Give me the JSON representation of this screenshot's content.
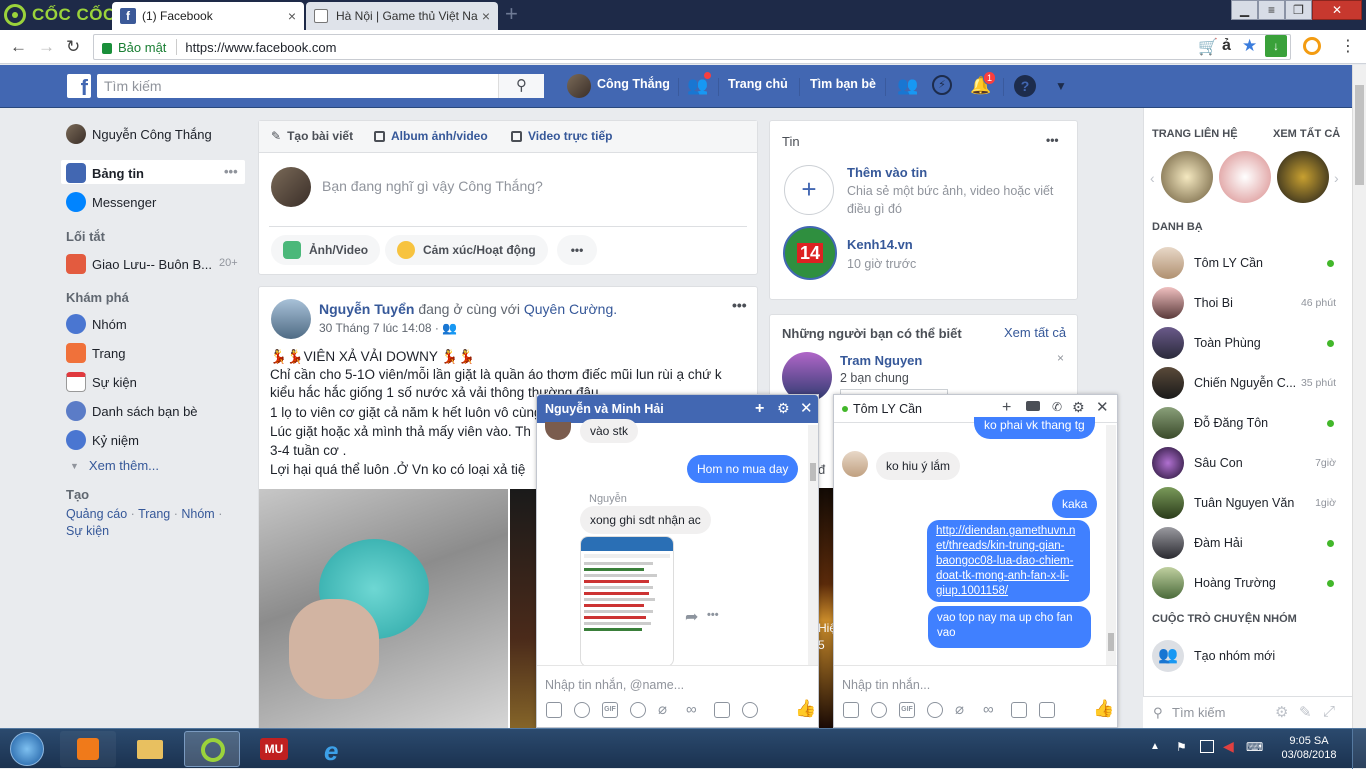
{
  "browser": {
    "brand": "CỐC CỐC",
    "tabs": [
      {
        "title": "(1) Facebook",
        "favicon": "f"
      },
      {
        "title": "Hà Nội | Game thủ Việt Na"
      }
    ],
    "url": "https://www.facebook.com",
    "secure_label": "Bảo mật",
    "lang_badge": "ả",
    "window_controls": [
      "▁",
      "❐",
      "✕"
    ]
  },
  "fb_header": {
    "search_placeholder": "Tìm kiếm",
    "user_name": "Công Thắng",
    "links": [
      "Trang chủ",
      "Tìm bạn bè"
    ],
    "notif_count": "1",
    "colors": {
      "bar": "#4267b2"
    }
  },
  "left_nav": {
    "profile": "Nguyễn Công Thắng",
    "main": [
      {
        "label": "Bảng tin",
        "icon": "news-feed-icon"
      },
      {
        "label": "Messenger",
        "icon": "messenger-icon"
      }
    ],
    "shortcuts_title": "Lối tắt",
    "shortcuts": [
      {
        "label": "Giao Lưu-- Buôn B...",
        "count": "20+"
      }
    ],
    "explore_title": "Khám phá",
    "explore": [
      "Nhóm",
      "Trang",
      "Sự kiện",
      "Danh sách bạn bè",
      "Kỷ niệm"
    ],
    "see_more": "Xem thêm...",
    "create_title": "Tạo",
    "create_links": [
      "Quảng cáo",
      "Trang",
      "Nhóm",
      "Sự kiện"
    ]
  },
  "composer": {
    "tabs": [
      "Tạo bài viết",
      "Album ảnh/video",
      "Video trực tiếp"
    ],
    "placeholder": "Bạn đang nghĩ gì vậy Công Thắng?",
    "actions": [
      "Ảnh/Video",
      "Cảm xúc/Hoạt động",
      "•••"
    ]
  },
  "post": {
    "author": "Nguyễn Tuyển",
    "with_text": "đang ở cùng với",
    "with_name": "Quyên Cường.",
    "time": "30 Tháng 7 lúc 14:08 ·",
    "lines": [
      "💃💃VIÊN XẢ VẢI DOWNY 💃💃",
      "Chỉ cần cho 5-1O viên/mỗi lần giặt là quần áo thơm điếc mũi lun rùi ạ chứ k",
      "kiểu hắc hắc giống 1 số nước xả vải thông thường đâu",
      "1 lọ to viên cơ giặt cả năm k hết luôn vô cùng",
      "Lúc giặt hoặc xả mình thả mấy viên vào. Th",
      "3-4 tuần cơ .",
      "Lợi hại quá thể luôn .Ở Vn ko có loại xả tiệ"
    ]
  },
  "stories": {
    "title": "Tin",
    "add_title": "Thêm vào tin",
    "add_desc_1": "Chia sẻ một bức ảnh, video hoặc viết",
    "add_desc_2": "điều gì đó",
    "item_name": "Kenh14.vn",
    "item_time": "10 giờ trước",
    "item_logo": "14"
  },
  "pymk": {
    "title": "Những người bạn có thể biết",
    "see_all": "Xem tất cả",
    "person": "Tram Nguyen",
    "mutual": "2 bạn chung"
  },
  "behind_text": {
    "a": "đ",
    "b": "Hiệ",
    "c": "5"
  },
  "chat1": {
    "title": "Nguyễn và Minh Hải",
    "messages": [
      {
        "text": "vào stk",
        "side": "in"
      },
      {
        "text": "Hom no mua day",
        "side": "out"
      },
      {
        "sender": "Nguyễn"
      },
      {
        "text": "xong ghi sdt nhận ac",
        "side": "in"
      }
    ],
    "input_placeholder": "Nhập tin nhắn, @name..."
  },
  "chat2": {
    "title": "Tôm LY Cần",
    "messages": [
      {
        "text": "ko phai vk thang tg",
        "side": "out"
      },
      {
        "text": "ko hiu ý lắm",
        "side": "in"
      },
      {
        "text": "kaka",
        "side": "out"
      },
      {
        "text": "http://diendan.gamethuvn.n|et/threads/kin-trung-gian-|baongoc08-lua-dao-chiem-|doat-tk-mong-anh-fan-x-li-|giup.1001158/",
        "side": "out"
      },
      {
        "text": "vao top nay ma up cho fan|vao",
        "side": "out"
      }
    ],
    "link_lines": [
      "http://diendan.gamethuvn.n",
      "et/threads/kin-trung-gian-",
      "baongoc08-lua-dao-chiem-",
      "doat-tk-mong-anh-fan-x-li-",
      "giup.1001158/"
    ],
    "last_lines": [
      "vao top nay ma up cho fan",
      "vao"
    ],
    "input_placeholder": "Nhập tin nhắn..."
  },
  "right_sidebar": {
    "contacts_header": "TRANG LIÊN HỆ",
    "see_all": "XEM TẤT CẢ",
    "directory_title": "DANH BẠ",
    "contacts": [
      {
        "name": "Tôm LY Cần",
        "status": "online"
      },
      {
        "name": "Thoi Bi",
        "status": "46 phút"
      },
      {
        "name": "Toàn Phùng",
        "status": "online"
      },
      {
        "name": "Chiến Nguyễn C...",
        "status": "35 phút"
      },
      {
        "name": "Đỗ Đăng Tôn",
        "status": "online"
      },
      {
        "name": "Sâu Con",
        "status": "7giờ"
      },
      {
        "name": "Tuân Nguyen Văn",
        "status": "1giờ"
      },
      {
        "name": "Đàm Hải",
        "status": "online"
      },
      {
        "name": "Hoàng Trường",
        "status": "online"
      }
    ],
    "group_title": "CUỘC TRÒ CHUYỆN NHÓM",
    "create_group": "Tạo nhóm mới",
    "search_placeholder": "Tìm kiếm"
  },
  "taskbar": {
    "time": "9:05 SA",
    "date": "03/08/2018"
  }
}
